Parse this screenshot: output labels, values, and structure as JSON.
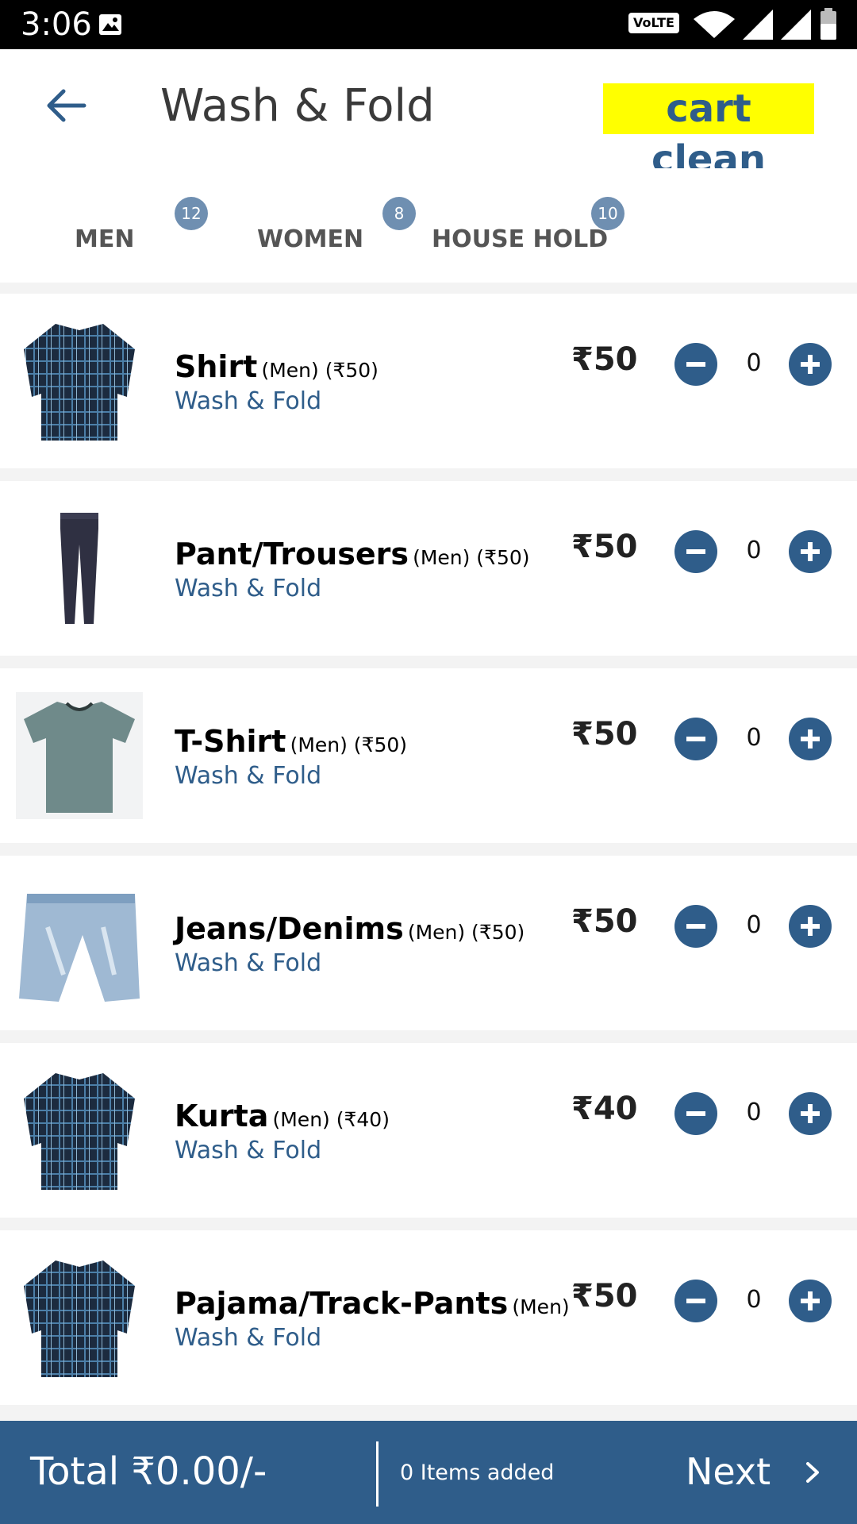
{
  "status_bar": {
    "time": "3:06",
    "volte_label": "VoLTE",
    "icons": [
      "image-icon",
      "wifi-icon",
      "signal-icon",
      "signal-icon",
      "battery-icon"
    ]
  },
  "header": {
    "title": "Wash & Fold",
    "cart_clean_label": "cart clean",
    "back_icon": "back-arrow-icon"
  },
  "tabs": [
    {
      "label": "MEN",
      "count": "12"
    },
    {
      "label": "WOMEN",
      "count": "8"
    },
    {
      "label": "HOUSE HOLD",
      "count": "10"
    }
  ],
  "items": [
    {
      "name": "Shirt",
      "meta": "(Men) (₹50)",
      "service": "Wash & Fold",
      "price": "₹50",
      "qty": "0",
      "image": "shirt-image"
    },
    {
      "name": "Pant/Trousers",
      "meta": "(Men) (₹50)",
      "service": "Wash & Fold",
      "price": "₹50",
      "qty": "0",
      "image": "trousers-image"
    },
    {
      "name": "T-Shirt",
      "meta": "(Men) (₹50)",
      "service": "Wash & Fold",
      "price": "₹50",
      "qty": "0",
      "image": "tshirt-image"
    },
    {
      "name": "Jeans/Denims",
      "meta": "(Men) (₹50)",
      "service": "Wash & Fold",
      "price": "₹50",
      "qty": "0",
      "image": "jeans-image"
    },
    {
      "name": "Kurta",
      "meta": "(Men) (₹40)",
      "service": "Wash & Fold",
      "price": "₹40",
      "qty": "0",
      "image": "shirt-image"
    },
    {
      "name": "Pajama/Track-Pants",
      "meta": "(Men)",
      "service": "Wash & Fold",
      "price": "₹50",
      "qty": "0",
      "image": "shirt-image"
    }
  ],
  "footer": {
    "total": "Total ₹0.00/-",
    "items_added": "0 Items added",
    "next_label": "Next"
  },
  "colors": {
    "primary": "#2f5d8a",
    "badge": "#6f8fb1",
    "highlight": "#ffff00"
  }
}
